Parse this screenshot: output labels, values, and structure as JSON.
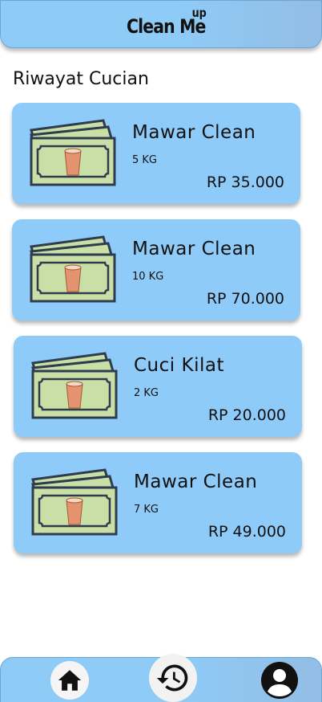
{
  "header": {
    "logo_main": "Clean Me",
    "logo_sup": "up"
  },
  "page": {
    "title": "Riwayat Cucian"
  },
  "orders": [
    {
      "name": "Mawar Clean",
      "weight": "5 KG",
      "price": "RP 35.000"
    },
    {
      "name": "Mawar Clean",
      "weight": "10 KG",
      "price": "RP 70.000"
    },
    {
      "name": "Cuci Kilat",
      "weight": "2 KG",
      "price": "RP 20.000"
    },
    {
      "name": "Mawar Clean",
      "weight": "7 KG",
      "price": "RP 49.000"
    }
  ],
  "nav": {
    "items": [
      {
        "icon": "home-icon"
      },
      {
        "icon": "history-icon"
      },
      {
        "icon": "profile-icon"
      }
    ]
  },
  "colors": {
    "card": "#8fcbf8",
    "header": "#8ecbf7",
    "ticket_fill": "#c8e0a6",
    "ticket_stroke": "#2f3c4f",
    "basket": "#e4936f"
  }
}
